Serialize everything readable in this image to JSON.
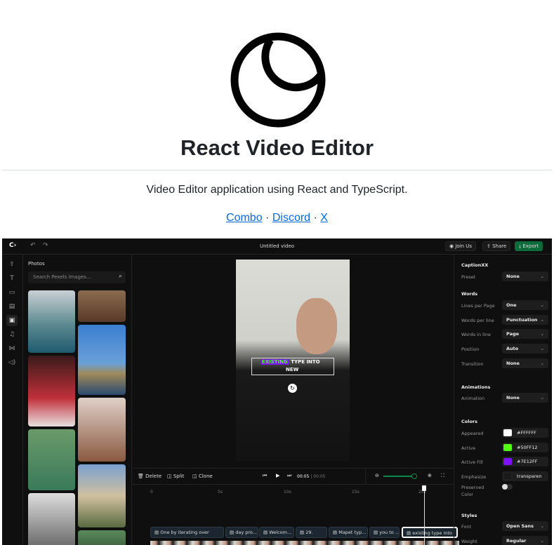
{
  "readme": {
    "title": "React Video Editor",
    "description": "Video Editor application using React and TypeScript.",
    "links": [
      "Combo",
      "Discord",
      "X"
    ],
    "separator": "·"
  },
  "editor": {
    "logo": "C›",
    "title": "Untitled video",
    "buttons": {
      "join": "Join Us",
      "share": "Share",
      "export": "Export"
    },
    "photos": {
      "heading": "Photos",
      "search_placeholder": "Search Pexels images..."
    },
    "caption_overlay": {
      "highlight": "EXISTING",
      "rest": "TYPE INTO",
      "line2": "NEW"
    },
    "toolbar": {
      "delete": "Delete",
      "split": "Split",
      "clone": "Clone",
      "time_current": "00:05",
      "time_total": "00:05",
      "zoom_level": 0.95
    },
    "ruler": [
      "0",
      "5s",
      "10s",
      "15s",
      "20s"
    ],
    "clips": [
      "One by iterating over",
      "day pro...",
      "Welcom...",
      "29.",
      "Mapet typ...",
      "you to ...",
      "existing type into"
    ],
    "panel": {
      "title": "CaptionXX",
      "preset_label": "Preset",
      "preset": "None",
      "words_heading": "Words",
      "words": [
        {
          "label": "Lines per Page",
          "value": "One"
        },
        {
          "label": "Words per line",
          "value": "Punctuation"
        },
        {
          "label": "Words in line",
          "value": "Page"
        },
        {
          "label": "Position",
          "value": "Auto"
        },
        {
          "label": "Transition",
          "value": "None"
        }
      ],
      "animations_heading": "Animations",
      "animation_label": "Animation",
      "animation": "None",
      "colors_heading": "Colors",
      "colors": [
        {
          "label": "Appeared",
          "value": "#FFFFFF",
          "swatch": "#FFFFFF"
        },
        {
          "label": "Active",
          "value": "#50FF12",
          "swatch": "#50FF12"
        },
        {
          "label": "Active Fill",
          "value": "#7E12FF",
          "swatch": "#7E12FF"
        },
        {
          "label": "Emphasize",
          "value": "transparen",
          "swatch": "#1a1a1a"
        }
      ],
      "preserved_label": "Preserved Color",
      "preserved_on": false,
      "styles_heading": "Styles",
      "font_label": "Font",
      "font": "Open Sans",
      "weight_label": "Weight",
      "weight": "Regular"
    }
  }
}
